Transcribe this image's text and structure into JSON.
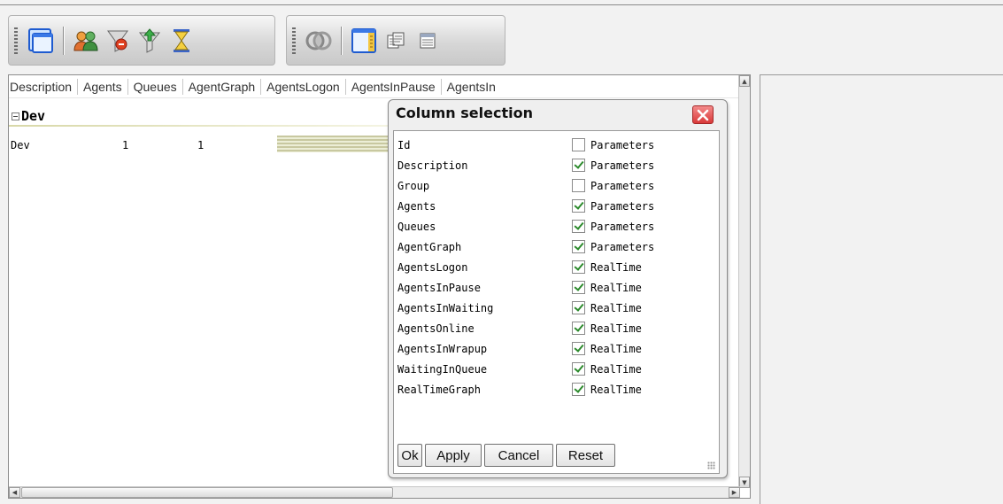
{
  "toolbar": {
    "group1": [
      {
        "icon": "window-icon"
      },
      {
        "icon": "users-icon"
      },
      {
        "icon": "filter-red-icon"
      },
      {
        "icon": "filter-green-icon"
      },
      {
        "icon": "hourglass-icon"
      }
    ],
    "group2": [
      {
        "icon": "overlap-rings-icon"
      },
      {
        "icon": "columns-panel-icon"
      },
      {
        "icon": "export-icon"
      },
      {
        "icon": "list-view-icon"
      }
    ]
  },
  "grid": {
    "columns": [
      "Description",
      "Agents",
      "Queues",
      "AgentGraph",
      "AgentsLogon",
      "AgentsInPause",
      "AgentsIn"
    ],
    "group_label": "Dev",
    "row": {
      "description": "Dev",
      "agents": "1",
      "queues": "1"
    }
  },
  "dialog": {
    "title": "Column selection",
    "columns": [
      {
        "name": "Id",
        "checked": false,
        "type": "Parameters"
      },
      {
        "name": "Description",
        "checked": true,
        "type": "Parameters"
      },
      {
        "name": "Group",
        "checked": false,
        "type": "Parameters"
      },
      {
        "name": "Agents",
        "checked": true,
        "type": "Parameters"
      },
      {
        "name": "Queues",
        "checked": true,
        "type": "Parameters"
      },
      {
        "name": "AgentGraph",
        "checked": true,
        "type": "Parameters"
      },
      {
        "name": "AgentsLogon",
        "checked": true,
        "type": "RealTime"
      },
      {
        "name": "AgentsInPause",
        "checked": true,
        "type": "RealTime"
      },
      {
        "name": "AgentsInWaiting",
        "checked": true,
        "type": "RealTime"
      },
      {
        "name": "AgentsOnline",
        "checked": true,
        "type": "RealTime"
      },
      {
        "name": "AgentsInWrapup",
        "checked": true,
        "type": "RealTime"
      },
      {
        "name": "WaitingInQueue",
        "checked": true,
        "type": "RealTime"
      },
      {
        "name": "RealTimeGraph",
        "checked": true,
        "type": "RealTime"
      }
    ],
    "buttons": {
      "ok": "Ok",
      "apply": "Apply",
      "cancel": "Cancel",
      "reset": "Reset"
    }
  },
  "colors": {
    "close_button": "#d93939",
    "check_mark": "#2c8a2c",
    "graph_bar": "#c8c8a0"
  }
}
